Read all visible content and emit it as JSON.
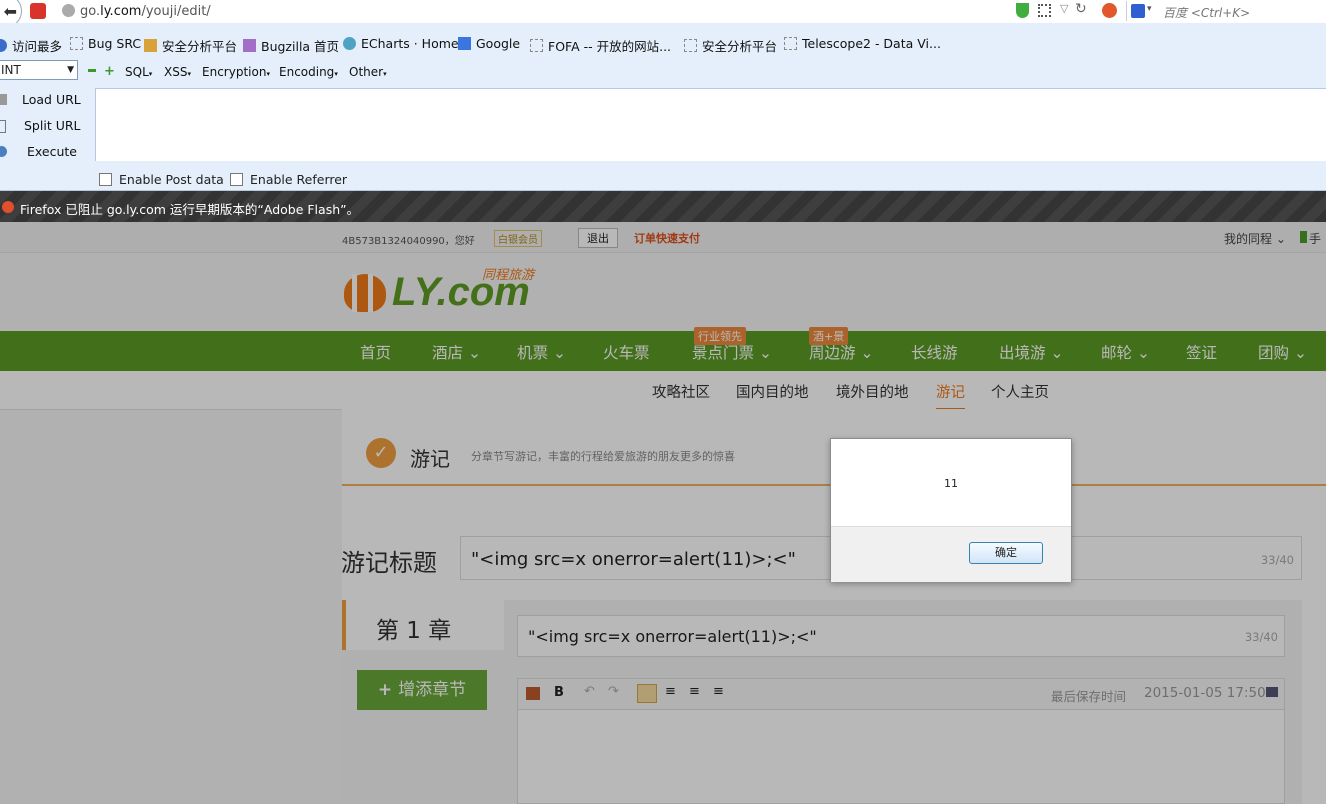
{
  "browser": {
    "url_prefix": "go.",
    "url_host": "ly.com",
    "url_path": "/youji/edit/",
    "search_placeholder": "百度 <Ctrl+K>"
  },
  "bookmarks": [
    "访问最多",
    "Bug SRC",
    "安全分析平台",
    "Bugzilla 首页",
    "ECharts · Home",
    "Google",
    "FOFA -- 开放的网站...",
    "安全分析平台",
    "Telescope2 - Data Vi..."
  ],
  "hackbar": {
    "select_value": "INT",
    "menus": [
      "SQL",
      "XSS",
      "Encryption",
      "Encoding",
      "Other"
    ],
    "load_url": "Load URL",
    "split_url": "Split URL",
    "execute": "Execute",
    "enable_post": "Enable Post data",
    "enable_referrer": "Enable Referrer"
  },
  "notification": {
    "text": "Firefox 已阻止 go.ly.com 运行早期版本的“Adobe Flash”。"
  },
  "site": {
    "user_greeting": "4B573B1324040990，您好",
    "member_badge": "白银会员",
    "logout": "退出",
    "quick_pay": "订单快速支付",
    "my_ly": "我的同程",
    "mobile": "手",
    "logo_text": "LY.com",
    "logo_cn": "同程旅游",
    "nav": [
      {
        "label": "首页",
        "arrow": ""
      },
      {
        "label": "酒店",
        "arrow": "⌄"
      },
      {
        "label": "机票",
        "arrow": "⌄"
      },
      {
        "label": "火车票",
        "arrow": ""
      },
      {
        "label": "景点门票",
        "arrow": "⌄"
      },
      {
        "label": "周边游",
        "arrow": "⌄"
      },
      {
        "label": "长线游",
        "arrow": ""
      },
      {
        "label": "出境游",
        "arrow": "⌄"
      },
      {
        "label": "邮轮",
        "arrow": "⌄"
      },
      {
        "label": "签证",
        "arrow": ""
      },
      {
        "label": "团购",
        "arrow": "⌄"
      }
    ],
    "badges": {
      "industry": "行业领先",
      "hotel_scenic": "酒+景"
    },
    "subnav": [
      "攻略社区",
      "国内目的地",
      "境外目的地",
      "游记",
      "个人主页"
    ],
    "section_title": "游记",
    "section_desc": "分章节写游记，丰富的行程给爱旅游的朋友更多的惊喜",
    "title_label": "游记标题",
    "title_value": "\"<img src=x onerror=alert(11)>;<\"",
    "title_count": "33/40",
    "chapter_label": "第 1 章",
    "chapter_value": "\"<img src=x onerror=alert(11)>;<\"",
    "chapter_count": "33/40",
    "add_chapter": "增添章节",
    "last_saved_label": "最后保存时间",
    "last_saved_time": "2015-01-05 17:50"
  },
  "dialog": {
    "message": "11",
    "ok": "确定"
  }
}
